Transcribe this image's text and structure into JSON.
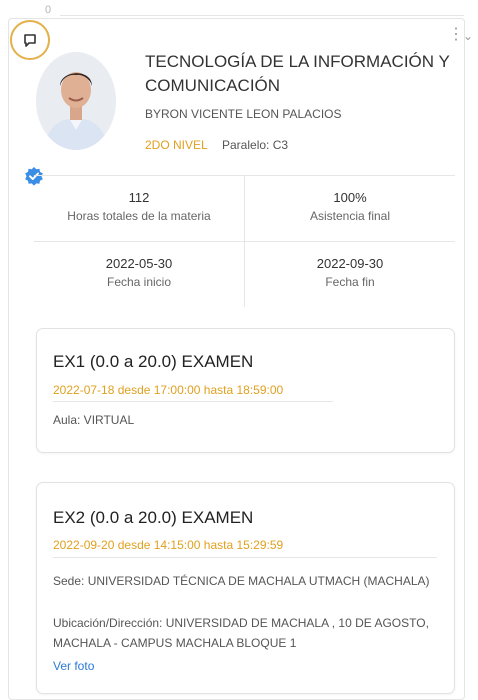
{
  "header": {
    "counter": "0"
  },
  "course": {
    "title": "TECNOLOGÍA DE LA INFORMACIÓN Y COMUNICACIÓN",
    "teacher": "BYRON VICENTE LEON PALACIOS",
    "level": "2DO NIVEL",
    "paralelo": "Paralelo: C3"
  },
  "stats": [
    {
      "value": "112",
      "label": "Horas totales de la materia"
    },
    {
      "value": "100%",
      "label": "Asistencia final"
    },
    {
      "value": "2022-05-30",
      "label": "Fecha inicio"
    },
    {
      "value": "2022-09-30",
      "label": "Fecha fin"
    }
  ],
  "exams": [
    {
      "title": "EX1 (0.0 a 20.0) EXAMEN",
      "date": "2022-07-18 desde 17:00:00 hasta 18:59:00",
      "aula": "Aula: VIRTUAL"
    },
    {
      "title": "EX2 (0.0 a 20.0) EXAMEN",
      "date": "2022-09-20 desde 14:15:00 hasta 15:29:59",
      "sede": "Sede: UNIVERSIDAD TÉCNICA DE MACHALA UTMACH (MACHALA)",
      "direccion": "Ubicación/Dirección: UNIVERSIDAD DE MACHALA , 10 DE AGOSTO, MACHALA - CAMPUS MACHALA BLOQUE 1",
      "ver_foto": "Ver foto"
    }
  ],
  "colors": {
    "accent": "#e0a020",
    "verified": "#3a8ee6",
    "link": "#2a7bd6"
  },
  "icons": {
    "chat": "chat-icon",
    "more": "more-vertical-icon",
    "chevron": "chevron-down-icon",
    "verified": "verified-badge-icon"
  }
}
